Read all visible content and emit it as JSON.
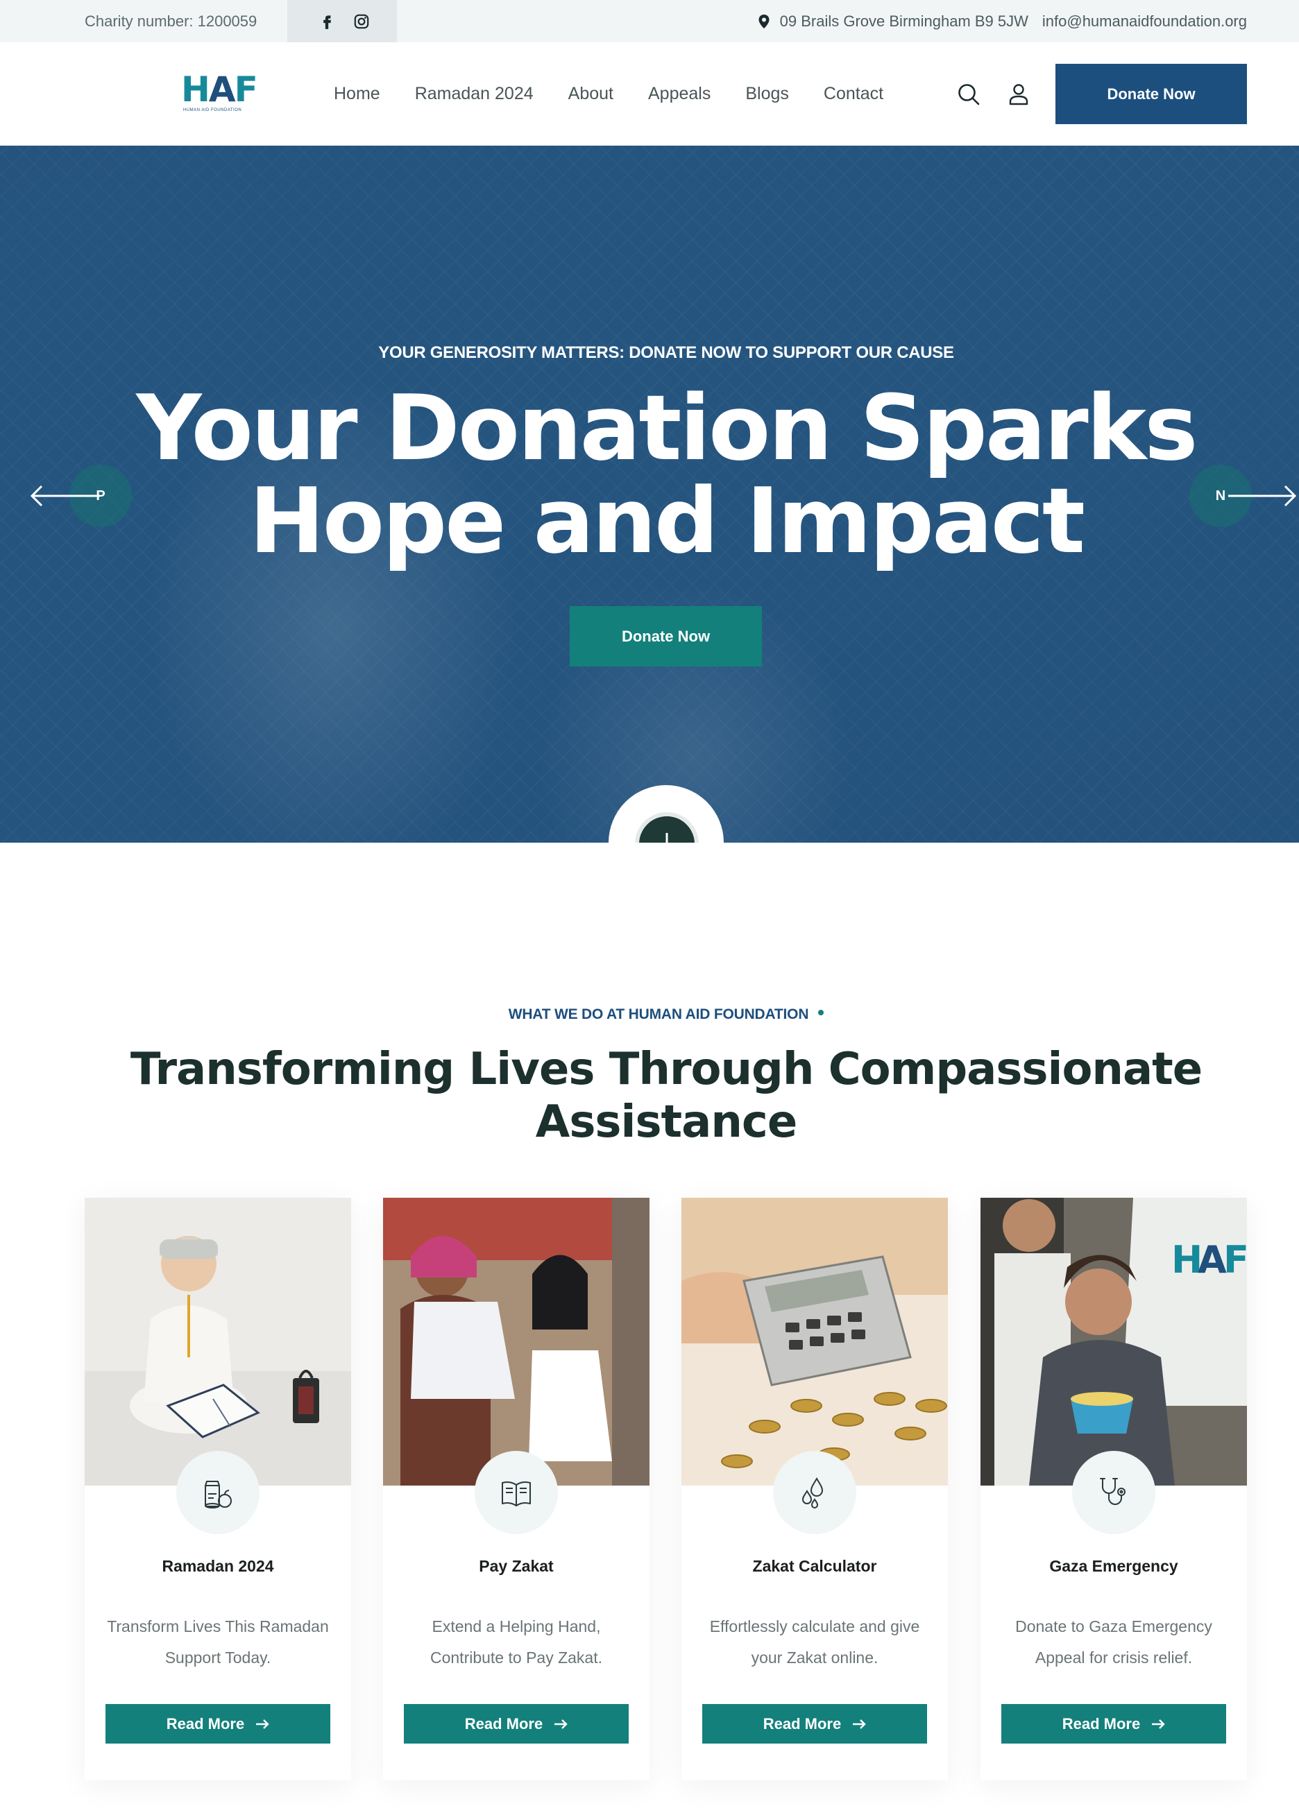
{
  "topbar": {
    "charity": "Charity number: 1200059",
    "social": [
      "facebook-icon",
      "instagram-icon"
    ],
    "address": "09 Brails Grove Birmingham B9 5JW",
    "email": "info@humanaidfoundation.org"
  },
  "header": {
    "logo_mark": "HAF",
    "logo_sub": "HUMAN AID FOUNDATION",
    "nav": [
      "Home",
      "Ramadan 2024",
      "About",
      "Appeals",
      "Blogs",
      "Contact"
    ],
    "donate_label": "Donate Now"
  },
  "hero": {
    "kicker": "YOUR GENEROSITY MATTERS: DONATE NOW TO SUPPORT OUR CAUSE",
    "title_line1": "Your Donation Sparks",
    "title_line2": "Hope and Impact",
    "donate_label": "Donate Now",
    "prev_label": "P",
    "next_label": "N"
  },
  "section": {
    "kicker": "WHAT WE DO AT HUMAN AID FOUNDATION",
    "title_line1": "Transforming Lives Through Compassionate",
    "title_line2": "Assistance"
  },
  "cards": [
    {
      "title": "Ramadan 2024",
      "desc": "Transform Lives This Ramadan Support Today.",
      "button": "Read More",
      "icon": "food-basket-icon"
    },
    {
      "title": "Pay Zakat",
      "desc": "Extend a Helping Hand, Contribute to Pay Zakat.",
      "button": "Read More",
      "icon": "book-icon"
    },
    {
      "title": "Zakat Calculator",
      "desc": "Effortlessly calculate and give your Zakat online.",
      "button": "Read More",
      "icon": "drops-icon"
    },
    {
      "title": "Gaza Emergency",
      "desc": "Donate to Gaza Emergency Appeal for crisis relief.",
      "button": "Read More",
      "icon": "stethoscope-icon"
    }
  ],
  "colors": {
    "brand_blue": "#1c4f7e",
    "brand_teal": "#13807b",
    "dark_text": "#1c302d"
  }
}
